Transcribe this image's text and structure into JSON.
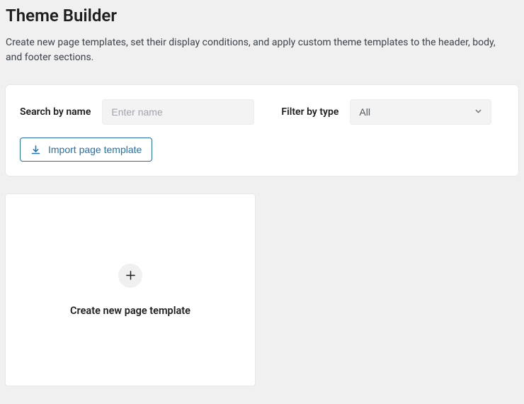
{
  "page": {
    "title": "Theme Builder",
    "description": "Create new page templates, set their display conditions, and apply custom theme templates to the header, body, and footer sections."
  },
  "toolbar": {
    "search_label": "Search by name",
    "search_placeholder": "Enter name",
    "search_value": "",
    "filter_label": "Filter by type",
    "filter_selected": "All",
    "import_label": "Import page template"
  },
  "tile": {
    "create_label": "Create new page template"
  },
  "icons": {
    "download": "download-icon",
    "chevron_down": "chevron-down-icon",
    "plus": "plus-icon"
  }
}
